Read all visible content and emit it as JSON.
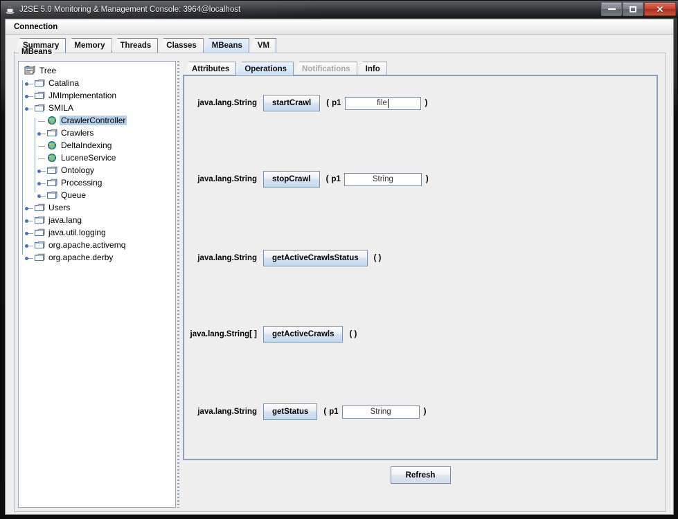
{
  "window": {
    "title": "J2SE 5.0 Monitoring & Management Console: 3964@localhost",
    "icon": "java-cup-icon",
    "minimize_label": "",
    "maximize_label": "",
    "close_label": "✕"
  },
  "menu": {
    "items": [
      "Connection"
    ]
  },
  "tabs": [
    {
      "label": "Summary",
      "selected": false
    },
    {
      "label": "Memory",
      "selected": false
    },
    {
      "label": "Threads",
      "selected": false
    },
    {
      "label": "Classes",
      "selected": false
    },
    {
      "label": "MBeans",
      "selected": true
    },
    {
      "label": "VM",
      "selected": false
    }
  ],
  "panel": {
    "legend": "MBeans"
  },
  "tree": {
    "root": {
      "label": "Tree",
      "icon": "tree-root-icon"
    },
    "nodes": [
      {
        "label": "Catalina",
        "depth": 1,
        "icon": "folder-icon",
        "handle": "expandable",
        "selected": false
      },
      {
        "label": "JMImplementation",
        "depth": 1,
        "icon": "folder-icon",
        "handle": "expandable",
        "selected": false
      },
      {
        "label": "SMILA",
        "depth": 1,
        "icon": "folder-icon",
        "handle": "expanded",
        "selected": false
      },
      {
        "label": "CrawlerController",
        "depth": 2,
        "icon": "mbean-icon",
        "handle": "leaf",
        "selected": true
      },
      {
        "label": "Crawlers",
        "depth": 2,
        "icon": "folder-icon",
        "handle": "expandable",
        "selected": false
      },
      {
        "label": "DeltaIndexing",
        "depth": 2,
        "icon": "mbean-icon",
        "handle": "leaf",
        "selected": false
      },
      {
        "label": "LuceneService",
        "depth": 2,
        "icon": "mbean-icon",
        "handle": "leaf",
        "selected": false
      },
      {
        "label": "Ontology",
        "depth": 2,
        "icon": "folder-icon",
        "handle": "expandable",
        "selected": false
      },
      {
        "label": "Processing",
        "depth": 2,
        "icon": "folder-icon",
        "handle": "expandable",
        "selected": false
      },
      {
        "label": "Queue",
        "depth": 2,
        "icon": "folder-icon",
        "handle": "expandable",
        "selected": false
      },
      {
        "label": "Users",
        "depth": 1,
        "icon": "folder-icon",
        "handle": "expandable",
        "selected": false
      },
      {
        "label": "java.lang",
        "depth": 1,
        "icon": "folder-icon",
        "handle": "expandable",
        "selected": false
      },
      {
        "label": "java.util.logging",
        "depth": 1,
        "icon": "folder-icon",
        "handle": "expandable",
        "selected": false
      },
      {
        "label": "org.apache.activemq",
        "depth": 1,
        "icon": "folder-icon",
        "handle": "expandable",
        "selected": false
      },
      {
        "label": "org.apache.derby",
        "depth": 1,
        "icon": "folder-icon",
        "handle": "expandable",
        "selected": false
      }
    ]
  },
  "inner_tabs": [
    {
      "label": "Attributes",
      "selected": false,
      "disabled": false
    },
    {
      "label": "Operations",
      "selected": true,
      "disabled": false
    },
    {
      "label": "Notifications",
      "selected": false,
      "disabled": true
    },
    {
      "label": "Info",
      "selected": false,
      "disabled": false
    }
  ],
  "operations": [
    {
      "return_type": "java.lang.String",
      "name": "startCrawl",
      "open_paren": "(",
      "param_label": "p1",
      "param_value": "file",
      "param_has_caret": true,
      "close_paren": ")",
      "has_params": true,
      "empty_parens": ""
    },
    {
      "return_type": "java.lang.String",
      "name": "stopCrawl",
      "open_paren": "(",
      "param_label": "p1",
      "param_value": "String",
      "param_has_caret": false,
      "close_paren": ")",
      "has_params": true,
      "empty_parens": ""
    },
    {
      "return_type": "java.lang.String",
      "name": "getActiveCrawlsStatus",
      "open_paren": "",
      "param_label": "",
      "param_value": "",
      "param_has_caret": false,
      "close_paren": "",
      "has_params": false,
      "empty_parens": "( )"
    },
    {
      "return_type": "java.lang.String[ ]",
      "name": "getActiveCrawls",
      "open_paren": "",
      "param_label": "",
      "param_value": "",
      "param_has_caret": false,
      "close_paren": "",
      "has_params": false,
      "empty_parens": "( )"
    },
    {
      "return_type": "java.lang.String",
      "name": "getStatus",
      "open_paren": "(",
      "param_label": "p1",
      "param_value": "String",
      "param_has_caret": false,
      "close_paren": ")",
      "has_params": true,
      "empty_parens": ""
    }
  ],
  "refresh": {
    "label": "Refresh"
  },
  "colors": {
    "selection_blue": "#b3cee7",
    "tab_selected": "#cfe2f7",
    "panel_bg": "#eeeeee",
    "border": "#8ba0bd",
    "disabled_text": "#a9a9a9"
  }
}
